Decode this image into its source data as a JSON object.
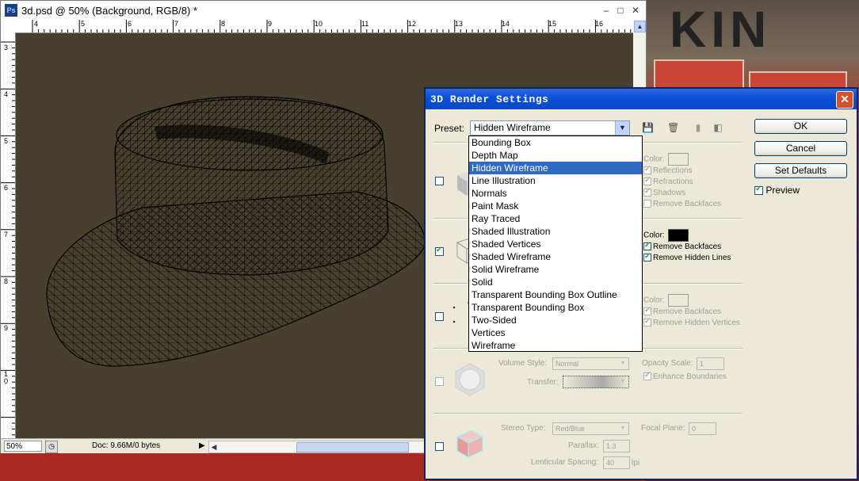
{
  "document": {
    "title": "3d.psd @ 50% (Background, RGB/8) *",
    "app_icon": "Ps",
    "ruler_top_ticks": [
      "4",
      "5",
      "6",
      "7",
      "8",
      "9",
      "10",
      "11",
      "12",
      "13",
      "14",
      "15",
      "16"
    ],
    "ruler_left_ticks": [
      "3",
      "4",
      "5",
      "6",
      "7",
      "8",
      "9",
      "1\n0"
    ],
    "status": {
      "zoom": "50%",
      "doc_info": "Doc: 9.66M/0 bytes"
    }
  },
  "dialog": {
    "title": "3D Render Settings",
    "preset_label": "Preset:",
    "preset_value": "Hidden Wireframe",
    "buttons": {
      "ok": "OK",
      "cancel": "Cancel",
      "set_defaults": "Set Defaults"
    },
    "preview_label": "Preview",
    "preview_checked": true,
    "face": {
      "enabled": false,
      "color_label": "Color:",
      "reflections": "Reflections",
      "refractions": "Refractions",
      "shadows": "Shadows",
      "remove_backfaces": "Remove Backfaces"
    },
    "edges": {
      "enabled": true,
      "color_label": "Color:",
      "color": "#000000",
      "remove_backfaces": "Remove Backfaces",
      "remove_hidden_lines": "Remove Hidden Lines"
    },
    "vertices": {
      "enabled": false,
      "color_label": "Color:",
      "remove_backfaces": "Remove Backfaces",
      "remove_hidden_vertices": "Remove Hidden Vertices"
    },
    "volume": {
      "enabled": false,
      "volume_style_label": "Volume Style:",
      "volume_style_value": "Normal",
      "transfer_label": "Transfer:",
      "opacity_scale_label": "Opacity Scale:",
      "opacity_scale_value": "1",
      "enhance_boundaries": "Enhance Boundaries"
    },
    "stereo": {
      "enabled": false,
      "stereo_type_label": "Stereo Type:",
      "stereo_type_value": "Red/Blue",
      "focal_plane_label": "Focal Plane:",
      "focal_plane_value": "0",
      "parallax_label": "Parallax:",
      "parallax_value": "1.3",
      "lenticular_label": "Lenticular Spacing:",
      "lenticular_value": "40",
      "lenticular_unit": "lpi"
    },
    "preset_options": [
      "Bounding Box",
      "Depth Map",
      "Hidden Wireframe",
      "Line Illustration",
      "Normals",
      "Paint Mask",
      "Ray Traced",
      "Shaded Illustration",
      "Shaded Vertices",
      "Shaded Wireframe",
      "Solid Wireframe",
      "Solid",
      "Transparent Bounding Box Outline",
      "Transparent Bounding Box",
      "Two-Sided",
      "Vertices",
      "Wireframe"
    ],
    "selected_index": 2
  },
  "colors": {
    "canvas": "#48402f",
    "titlebar_blue": "#0a50d8",
    "selection": "#316ac5"
  }
}
